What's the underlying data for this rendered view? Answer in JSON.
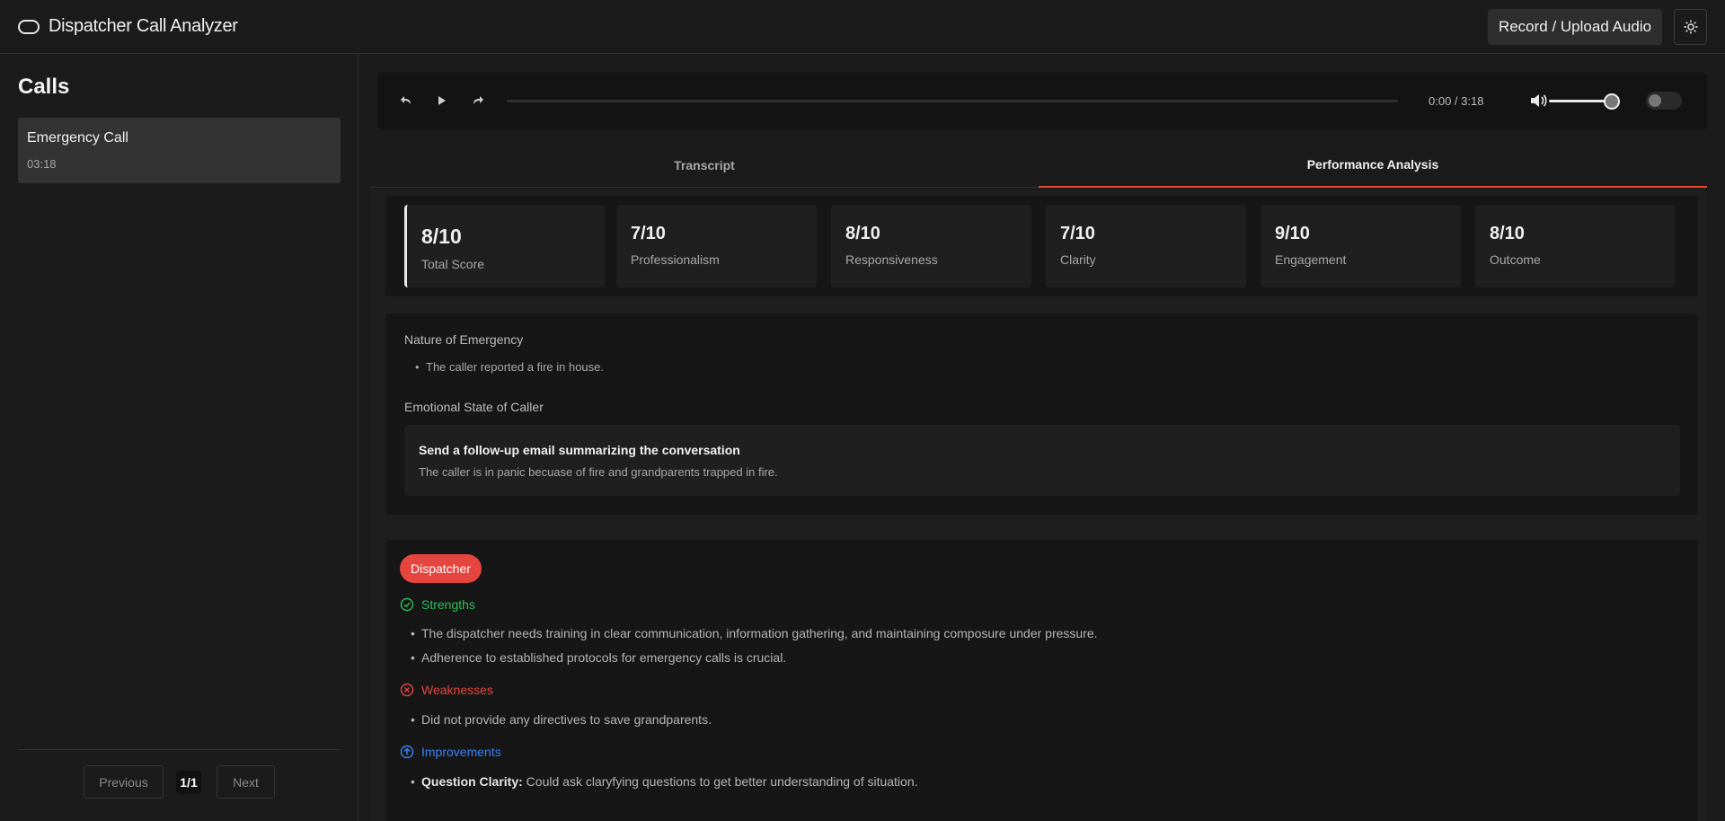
{
  "header": {
    "title": "Dispatcher Call Analyzer",
    "record_label": "Record / Upload Audio"
  },
  "sidebar": {
    "title": "Calls",
    "calls": [
      {
        "name": "Emergency Call",
        "duration": "03:18"
      }
    ],
    "pagination": {
      "prev": "Previous",
      "page": "1/1",
      "next": "Next"
    }
  },
  "player": {
    "time": "0:00 / 3:18",
    "progress": 0,
    "volume": 1.0
  },
  "tabs": [
    {
      "label": "Transcript",
      "active": false
    },
    {
      "label": "Performance Analysis",
      "active": true
    }
  ],
  "scores": [
    {
      "value": "8/10",
      "label": "Total Score"
    },
    {
      "value": "7/10",
      "label": "Professionalism"
    },
    {
      "value": "8/10",
      "label": "Responsiveness"
    },
    {
      "value": "7/10",
      "label": "Clarity"
    },
    {
      "value": "9/10",
      "label": "Engagement"
    },
    {
      "value": "8/10",
      "label": "Outcome"
    }
  ],
  "summary": {
    "nature_title": "Nature of Emergency",
    "nature_items": [
      "The caller reported a fire in house."
    ],
    "emotional_title": "Emotional State of Caller",
    "emotional_box_title": "Send a follow-up email summarizing the conversation",
    "emotional_box_text": "The caller is in panic becuase of fire and grandparents trapped in fire."
  },
  "dispatcher": {
    "role": "Dispatcher",
    "strengths_title": "Strengths",
    "strengths": [
      "The dispatcher needs training in clear communication, information gathering, and maintaining composure under pressure.",
      "Adherence to established protocols for emergency calls is crucial."
    ],
    "weaknesses_title": "Weaknesses",
    "weaknesses": [
      "Did not provide any directives to save grandparents."
    ],
    "improvements_title": "Improvements",
    "improvements": [
      {
        "label": "Question Clarity:",
        "text": " Could ask claryfying questions to get better understanding of situation."
      }
    ]
  },
  "colors": {
    "accent": "#e5452e",
    "strength": "#2fbf5a",
    "weakness": "#e5453f",
    "improvement": "#3b82f6"
  }
}
